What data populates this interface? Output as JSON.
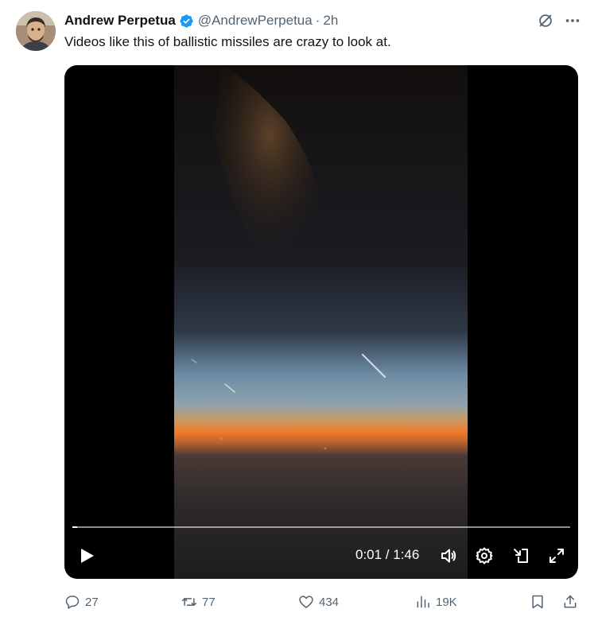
{
  "author": {
    "name": "Andrew Perpetua",
    "handle": "@AndrewPerpetua",
    "separator": "·",
    "time": "2h",
    "verified": true,
    "avatar_icon": "user-avatar"
  },
  "tweet": {
    "text": "Videos like this of ballistic missiles are crazy to look at."
  },
  "top_actions": {
    "icons": [
      "grok-icon",
      "more-icon"
    ]
  },
  "video": {
    "current_time": "0:01",
    "duration": "1:46",
    "timecode": "0:01 / 1:46",
    "progress_fraction": 0.01,
    "controls": [
      "play-icon",
      "volume-icon",
      "settings-icon",
      "picture-in-picture-icon",
      "fullscreen-icon"
    ]
  },
  "engagement": {
    "replies": "27",
    "reposts": "77",
    "likes": "434",
    "views": "19K"
  },
  "colors": {
    "verified_blue": "#1d9bf0",
    "secondary_text": "#536471",
    "primary_text": "#0f1419",
    "horizon_orange": "#f07a2a"
  }
}
